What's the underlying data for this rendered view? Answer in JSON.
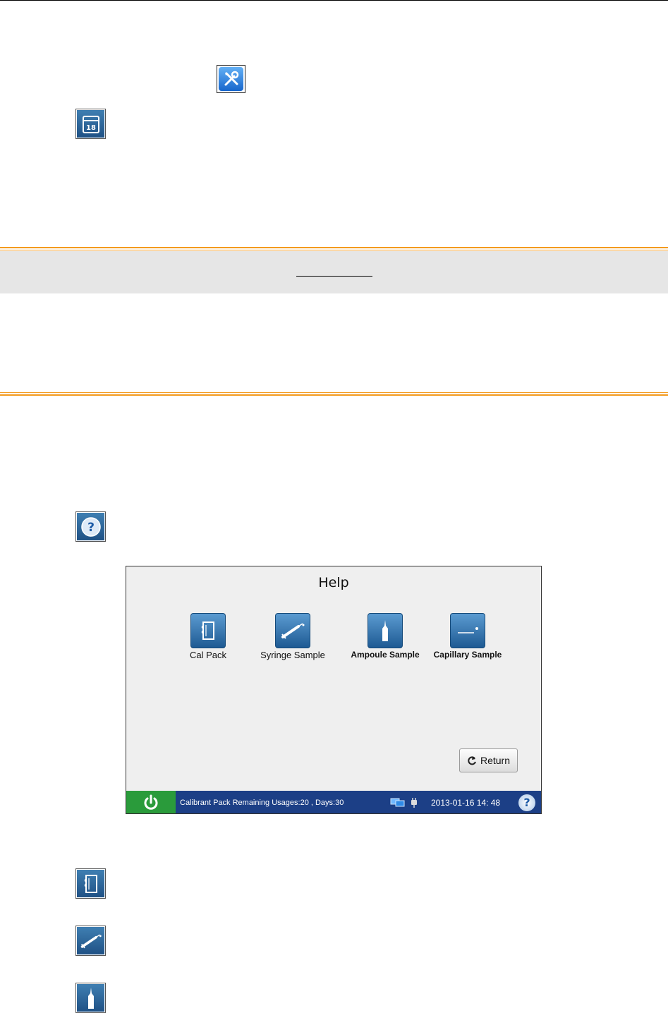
{
  "icons": {
    "tools": "tools-icon",
    "calendar": "calendar-icon",
    "help": "help-icon",
    "cal_pack": "cal-pack-icon",
    "syringe": "syringe-icon",
    "ampoule": "ampoule-icon"
  },
  "calendar_icon_text": "18",
  "help_screen": {
    "title": "Help",
    "tiles": [
      {
        "label": "Cal  Pack",
        "icon": "cal-pack-icon"
      },
      {
        "label": "Syringe Sample",
        "icon": "syringe-icon"
      },
      {
        "label": "Ampoule Sample",
        "icon": "ampoule-icon"
      },
      {
        "label": "Capillary Sample",
        "icon": "capillary-icon"
      }
    ],
    "return_label": "Return"
  },
  "status_bar": {
    "calibrant_text": "Calibrant Pack Remaining Usages:20 , Days:30",
    "datetime": "2013-01-16  14: 48",
    "help_glyph": "?"
  },
  "colors": {
    "accent_orange": "#f39a1e",
    "status_bar": "#1c3f86",
    "power_green": "#2a9b3b",
    "icon_blue": "#1f5185"
  }
}
